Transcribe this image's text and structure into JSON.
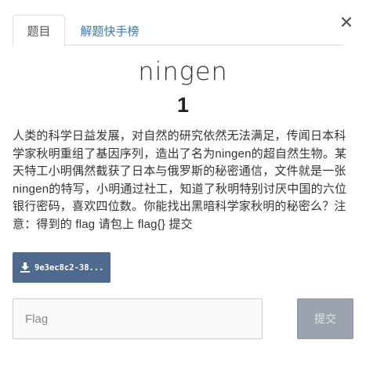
{
  "tabs": {
    "challenge": "题目",
    "solvers": "解题快手榜"
  },
  "challenge": {
    "name": "ningen",
    "points": "1",
    "description": "人类的科学日益发展，对自然的研究依然无法满足，传闻日本科学家秋明重组了基因序列，造出了名为ningen的超自然生物。某天特工小明偶然截获了日本与俄罗斯的秘密通信，文件就是一张ningen的特写，小明通过社工，知道了秋明特别讨厌中国的六位银行密码，喜欢四位数。你能找出黑暗科学家秋明的秘密么？注意：得到的 flag 请包上 flag{} 提交"
  },
  "download": {
    "filename": "9e3ec8c2-38...",
    "icon": "download-icon"
  },
  "flag_form": {
    "placeholder": "Flag",
    "submit_label": "提交"
  },
  "close_icon": "close-icon",
  "colors": {
    "link": "#337ab7",
    "download_bg": "#4e6a8e",
    "submit_bg": "#9aa4ae",
    "border": "#dddddd"
  }
}
